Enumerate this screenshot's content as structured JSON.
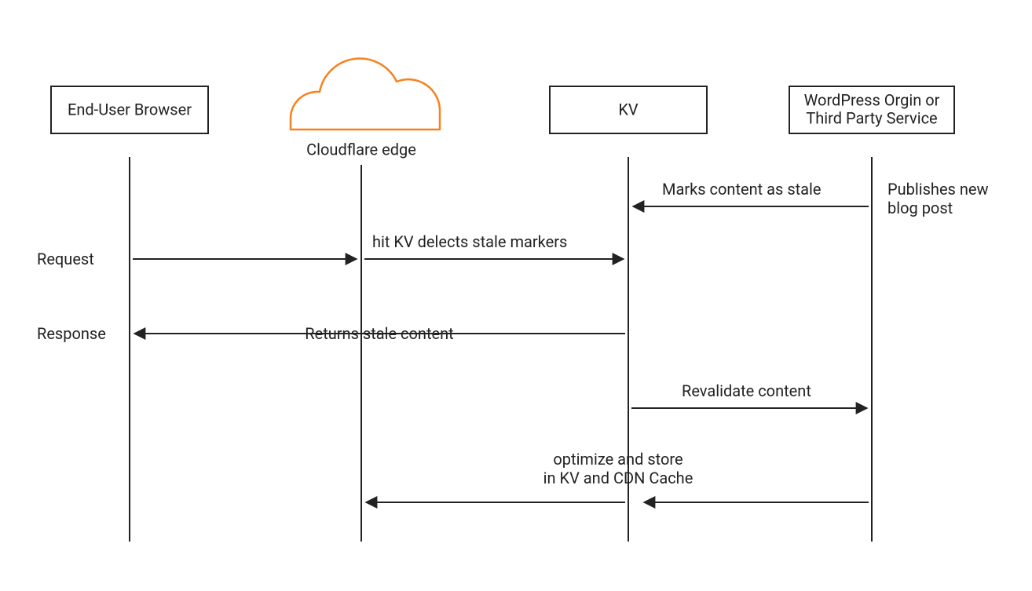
{
  "participants": {
    "browser": {
      "label": "End-User Browser"
    },
    "edge": {
      "label": "Cloudflare edge"
    },
    "kv": {
      "label": "KV"
    },
    "origin": {
      "label_l1": "WordPress Orgin or",
      "label_l2": "Third Party Service"
    }
  },
  "side_labels": {
    "request": "Request",
    "response": "Response"
  },
  "messages": {
    "marks_stale": "Marks content as stale",
    "publish_l1": "Publishes new",
    "publish_l2": "blog post",
    "hit_kv": "hit KV delects stale markers",
    "returns_stale": "Returns stale content",
    "revalidate": "Revalidate content",
    "optimize_l1": "optimize and store",
    "optimize_l2": "in KV and CDN Cache"
  },
  "colors": {
    "cloud": "#f6821f",
    "line": "#222222"
  }
}
